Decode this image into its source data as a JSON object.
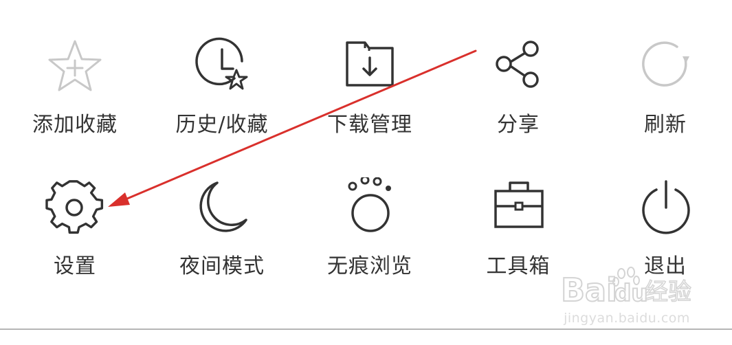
{
  "menu": {
    "row1": [
      {
        "label": "添加收藏",
        "icon": "star-plus-icon"
      },
      {
        "label": "历史/收藏",
        "icon": "clock-star-icon"
      },
      {
        "label": "下载管理",
        "icon": "download-folder-icon"
      },
      {
        "label": "分享",
        "icon": "share-icon"
      },
      {
        "label": "刷新",
        "icon": "refresh-icon"
      }
    ],
    "row2": [
      {
        "label": "设置",
        "icon": "gear-icon"
      },
      {
        "label": "夜间模式",
        "icon": "moon-icon"
      },
      {
        "label": "无痕浏览",
        "icon": "paw-icon"
      },
      {
        "label": "工具箱",
        "icon": "toolbox-icon"
      },
      {
        "label": "退出",
        "icon": "power-icon"
      }
    ]
  },
  "annotation": {
    "color": "#d9302c",
    "icon": "red-arrow-icon"
  },
  "watermark": {
    "brand": "Baidu经验",
    "url": "jingyan.baidu.com"
  },
  "colors": {
    "icon_dark": "#333333",
    "icon_disabled": "#c8c8c8",
    "label": "#333333"
  }
}
